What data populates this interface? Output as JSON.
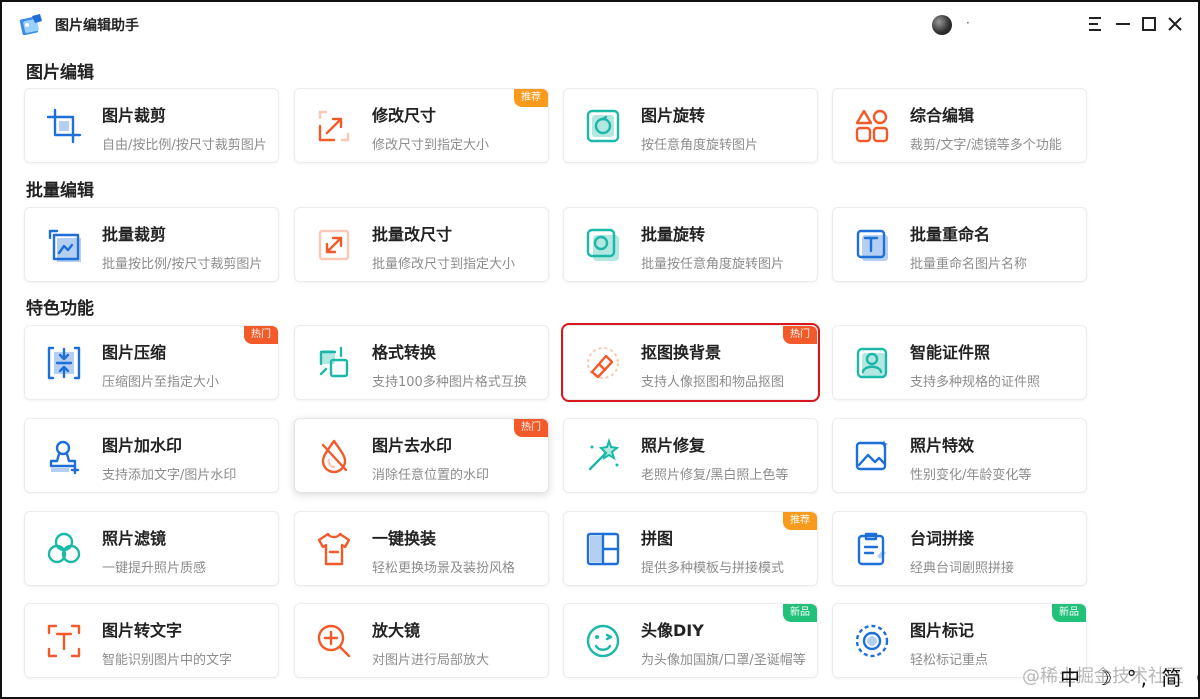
{
  "app": {
    "title": "图片编辑助手",
    "user_name": "·"
  },
  "sections": {
    "edit": "图片编辑",
    "batch": "批量编辑",
    "feature": "特色功能"
  },
  "cards": [
    {
      "id": "crop",
      "title": "图片裁剪",
      "desc": "自由/按比例/按尺寸裁剪图片",
      "icon": "crop-icon",
      "color": "#1f6fd8"
    },
    {
      "id": "resize",
      "title": "修改尺寸",
      "desc": "修改尺寸到指定大小",
      "icon": "resize-icon",
      "color": "#f35a2a",
      "badge": "推荐"
    },
    {
      "id": "rotate",
      "title": "图片旋转",
      "desc": "按任意角度旋转图片",
      "icon": "rotate-icon",
      "color": "#1cb8a8"
    },
    {
      "id": "combo",
      "title": "综合编辑",
      "desc": "裁剪/文字/滤镜等多个功能",
      "icon": "shapes-icon",
      "color": "#f35a2a"
    },
    {
      "id": "batch-crop",
      "title": "批量裁剪",
      "desc": "批量按比例/按尺寸裁剪图片",
      "icon": "batch-crop-icon",
      "color": "#1f6fd8"
    },
    {
      "id": "batch-resize",
      "title": "批量改尺寸",
      "desc": "批量修改尺寸到指定大小",
      "icon": "batch-resize-icon",
      "color": "#f35a2a"
    },
    {
      "id": "batch-rotate",
      "title": "批量旋转",
      "desc": "批量按任意角度旋转图片",
      "icon": "batch-rotate-icon",
      "color": "#1cb8a8"
    },
    {
      "id": "batch-rename",
      "title": "批量重命名",
      "desc": "批量重命名图片名称",
      "icon": "rename-icon",
      "color": "#1f6fd8"
    },
    {
      "id": "compress",
      "title": "图片压缩",
      "desc": "压缩图片至指定大小",
      "icon": "compress-icon",
      "color": "#1f6fd8",
      "badge": "热门"
    },
    {
      "id": "convert",
      "title": "格式转换",
      "desc": "支持100多种图片格式互换",
      "icon": "convert-icon",
      "color": "#1cb8a8"
    },
    {
      "id": "matting",
      "title": "抠图换背景",
      "desc": "支持人像抠图和物品抠图",
      "icon": "eraser-icon",
      "color": "#f35a2a",
      "badge": "热门"
    },
    {
      "id": "id-photo",
      "title": "智能证件照",
      "desc": "支持多种规格的证件照",
      "icon": "id-photo-icon",
      "color": "#1cb8a8"
    },
    {
      "id": "add-watermark",
      "title": "图片加水印",
      "desc": "支持添加文字/图片水印",
      "icon": "stamp-icon",
      "color": "#1f6fd8"
    },
    {
      "id": "remove-watermark",
      "title": "图片去水印",
      "desc": "消除任意位置的水印",
      "icon": "drop-slash-icon",
      "color": "#f35a2a",
      "badge": "热门"
    },
    {
      "id": "repair",
      "title": "照片修复",
      "desc": "老照片修复/黑白照上色等",
      "icon": "magic-wand-icon",
      "color": "#1cb8a8"
    },
    {
      "id": "effects",
      "title": "照片特效",
      "desc": "性别变化/年龄变化等",
      "icon": "photo-effect-icon",
      "color": "#1f6fd8"
    },
    {
      "id": "filter",
      "title": "照片滤镜",
      "desc": "一键提升照片质感",
      "icon": "filter-icon",
      "color": "#1cb8a8"
    },
    {
      "id": "outfit",
      "title": "一键换装",
      "desc": "轻松更换场景及装扮风格",
      "icon": "shirt-icon",
      "color": "#f35a2a"
    },
    {
      "id": "collage",
      "title": "拼图",
      "desc": "提供多种模板与拼接模式",
      "icon": "collage-icon",
      "color": "#1f6fd8",
      "badge": "推荐"
    },
    {
      "id": "subtitle",
      "title": "台词拼接",
      "desc": "经典台词剧照拼接",
      "icon": "clipboard-icon",
      "color": "#1f6fd8"
    },
    {
      "id": "ocr",
      "title": "图片转文字",
      "desc": "智能识别图片中的文字",
      "icon": "ocr-icon",
      "color": "#f35a2a"
    },
    {
      "id": "magnifier",
      "title": "放大镜",
      "desc": "对图片进行局部放大",
      "icon": "magnifier-icon",
      "color": "#f35a2a"
    },
    {
      "id": "avatar-diy",
      "title": "头像DIY",
      "desc": "为头像加国旗/口罩/圣诞帽等",
      "icon": "smiley-icon",
      "color": "#1cb8a8",
      "badge": "新品"
    },
    {
      "id": "annotate",
      "title": "图片标记",
      "desc": "轻松标记重点",
      "icon": "target-icon",
      "color": "#1f6fd8",
      "badge": "新品"
    }
  ],
  "badge_colors": {
    "推荐": "#f89a1c",
    "热门": "#f25a2a",
    "新品": "#21c17a"
  },
  "overlay": {
    "watermark": "@稀土掘金技术社区",
    "ime": "中 ☽ °, 简 ☺"
  }
}
